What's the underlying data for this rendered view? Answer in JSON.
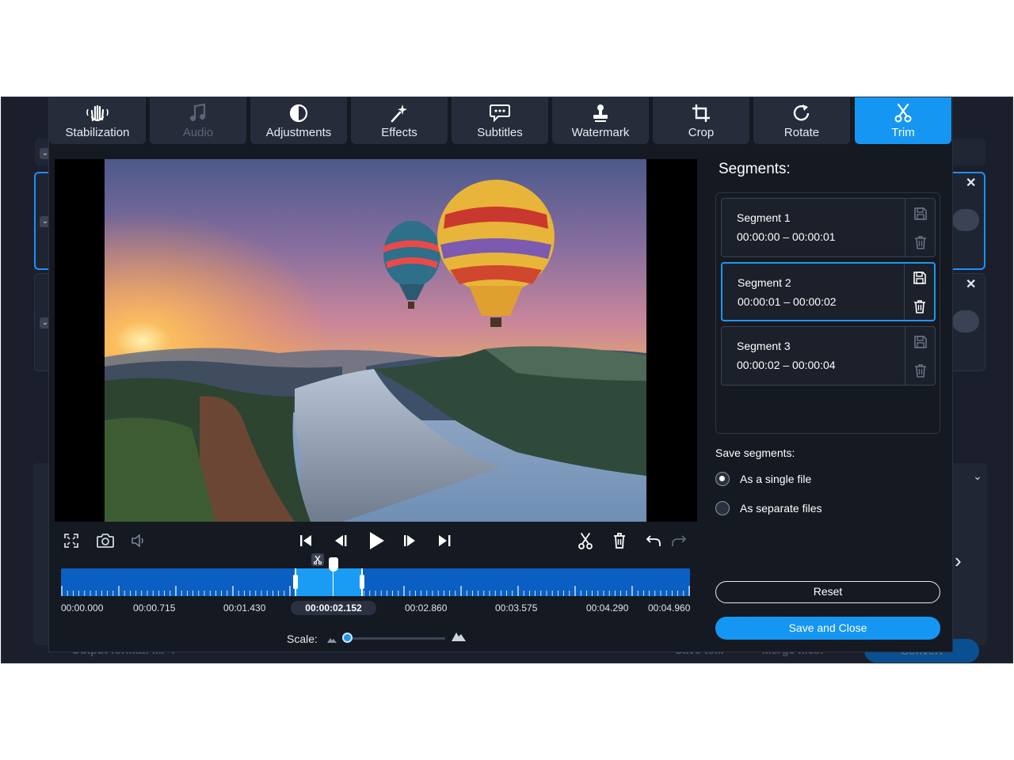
{
  "background_app": {
    "footer_output_label": "Output format: MP4",
    "footer_save_to": "Save to...",
    "footer_merge": "Merge files:",
    "footer_convert": "Convert",
    "help_symbol": "?",
    "close_symbol": "✕"
  },
  "tabs": [
    {
      "label": "Stabilization",
      "icon": "hand-icon",
      "state": "normal"
    },
    {
      "label": "Audio",
      "icon": "music-note-icon",
      "state": "disabled"
    },
    {
      "label": "Adjustments",
      "icon": "contrast-icon",
      "state": "normal"
    },
    {
      "label": "Effects",
      "icon": "magic-wand-icon",
      "state": "normal"
    },
    {
      "label": "Subtitles",
      "icon": "speech-bubble-icon",
      "state": "normal"
    },
    {
      "label": "Watermark",
      "icon": "stamp-icon",
      "state": "normal"
    },
    {
      "label": "Crop",
      "icon": "crop-icon",
      "state": "normal"
    },
    {
      "label": "Rotate",
      "icon": "rotate-icon",
      "state": "normal"
    },
    {
      "label": "Trim",
      "icon": "scissors-icon",
      "state": "active"
    }
  ],
  "timeline": {
    "labels": [
      "00:00.000",
      "00:00.715",
      "00:01.430",
      "00:02.860",
      "00:03.575",
      "00:04.290",
      "00:04.960"
    ],
    "current_time": "00:00:02.152"
  },
  "scale": {
    "label": "Scale:",
    "level": 0
  },
  "segments_panel": {
    "title": "Segments:",
    "segments": [
      {
        "name": "Segment 1",
        "range": "00:00:00 – 00:00:01",
        "active": false
      },
      {
        "name": "Segment 2",
        "range": "00:00:01 – 00:00:02",
        "active": true
      },
      {
        "name": "Segment 3",
        "range": "00:00:02 – 00:00:04",
        "active": false
      }
    ],
    "save_label": "Save segments:",
    "options": [
      {
        "label": "As a single file",
        "selected": true
      },
      {
        "label": "As separate files",
        "selected": false
      }
    ],
    "reset_label": "Reset",
    "save_close_label": "Save and Close"
  },
  "colors": {
    "accent": "#1596f2",
    "dialog_bg": "#151922",
    "tab_bg": "#262c3a",
    "timeline_track": "#0b5fc2"
  }
}
